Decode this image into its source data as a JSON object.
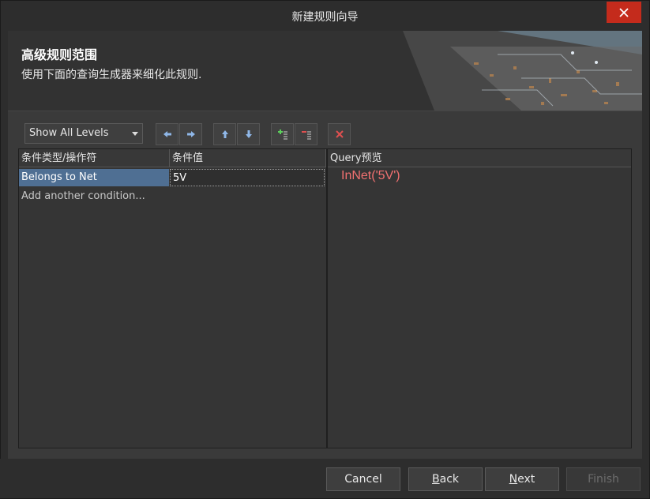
{
  "window": {
    "title": "新建规则向导",
    "close_icon": "close-icon"
  },
  "banner": {
    "heading": "高级规则范围",
    "subtitle": "使用下面的查询生成器来细化此规则."
  },
  "toolbar": {
    "levels_value": "Show All Levels",
    "buttons": [
      "arrow-left-icon",
      "arrow-right-icon",
      "arrow-up-icon",
      "arrow-down-icon",
      "add-condition-icon",
      "remove-condition-icon",
      "delete-icon"
    ]
  },
  "grid": {
    "col_type": "条件类型/操作符",
    "col_value": "条件值",
    "rows": [
      {
        "type": "Belongs to Net",
        "value": "5V"
      }
    ],
    "add_condition": "Add another condition..."
  },
  "preview": {
    "header": "Query预览",
    "query": "InNet('5V')"
  },
  "footer": {
    "cancel": "Cancel",
    "back_u": "B",
    "back_rest": "ack",
    "next_u": "N",
    "next_rest": "ext",
    "finish": "Finish"
  },
  "colors": {
    "accent_close": "#c42b1c",
    "selection": "#4f6f93",
    "query_text": "#f07070"
  }
}
